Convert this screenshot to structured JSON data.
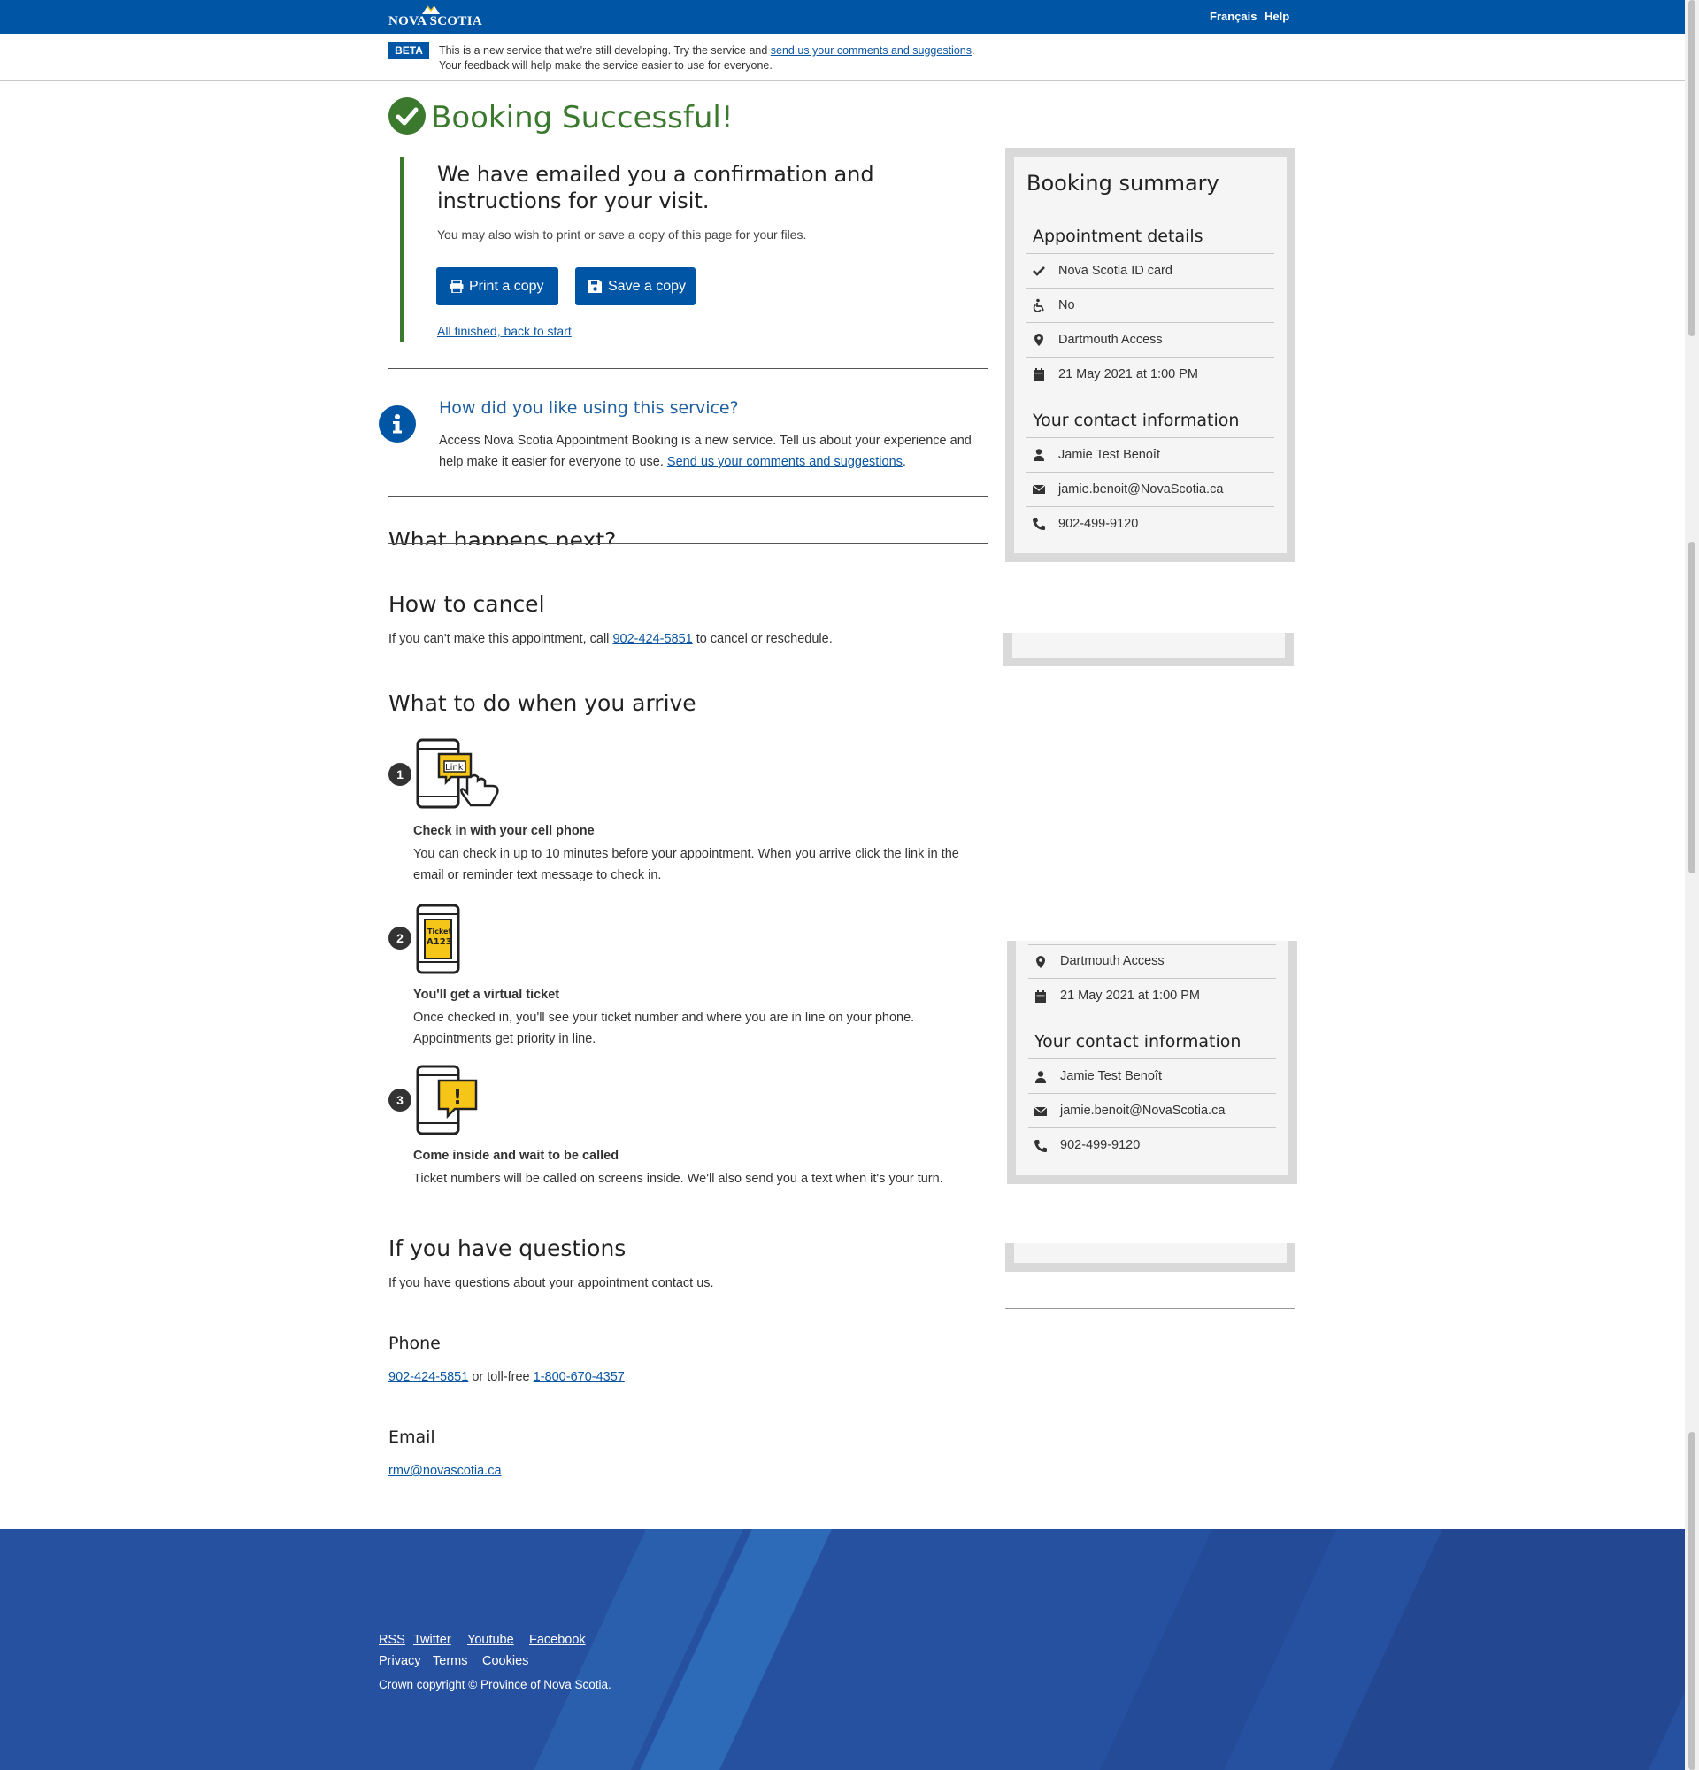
{
  "header": {
    "logo_text": "NOVA SCOTIA",
    "lang_link": "Français",
    "help_link": "Help"
  },
  "beta": {
    "badge": "BETA",
    "text_before": "This is a new service that we're still developing. Try the service and ",
    "link": "send us your comments and suggestions",
    "text_after": ".",
    "line2": "Your feedback will help make the service easier to use for everyone."
  },
  "success": {
    "title": "Booking Successful!",
    "heading": "We have emailed you a confirmation and instructions for your visit.",
    "subtext": "You may also wish to print or save a copy of this page for your files.",
    "print_label": "Print a copy",
    "save_label": "Save a copy",
    "finished_link": "All finished, back to start"
  },
  "feedback": {
    "question": "How did you like using this service?",
    "text": "Access Nova Scotia Appointment Booking is a new service. Tell us about your experience and help make it easier for everyone to use. ",
    "link": "Send us your comments and suggestions",
    "text_after": "."
  },
  "next": {
    "heading": "What happens next?"
  },
  "cancel": {
    "heading": "How to cancel",
    "text_before": "If you can't make this appointment, call ",
    "phone": "902-424-5851",
    "text_after": " to cancel or reschedule."
  },
  "arrive": {
    "heading": "What to do when you arrive",
    "steps": [
      {
        "num": "1",
        "title": "Check in with your cell phone",
        "text": "You can check in up to 10 minutes before your appointment. When you arrive click the link in the email or reminder text message to check in.",
        "illus_text": "Link"
      },
      {
        "num": "2",
        "title": "You'll get a virtual ticket",
        "text": "Once checked in, you'll see your ticket number and where you are in line on your phone. Appointments get priority in line.",
        "illus_text": "Ticket",
        "illus_text2": "A123"
      },
      {
        "num": "3",
        "title": "Come inside and wait to be called",
        "text": "Ticket numbers will be called on screens inside. We'll also send you a text when it's your turn.",
        "illus_text": "!"
      }
    ]
  },
  "questions": {
    "heading": "If you have questions",
    "text": "If you have questions about your appointment contact us.",
    "phone_heading": "Phone",
    "phone": "902-424-5851",
    "phone_mid": " or toll-free ",
    "tollfree": "1-800-670-4357",
    "email_heading": "Email",
    "email": "rmv@novascotia.ca"
  },
  "summary": {
    "title": "Booking summary",
    "appointment_heading": "Appointment details",
    "appointment": [
      {
        "icon": "check-icon",
        "text": "Nova Scotia ID card"
      },
      {
        "icon": "wheelchair-icon",
        "text": "No"
      },
      {
        "icon": "map-marker-icon",
        "text": "Dartmouth Access"
      },
      {
        "icon": "calendar-icon",
        "text": "21 May 2021 at 1:00 PM"
      }
    ],
    "contact_heading": "Your contact information",
    "contact": [
      {
        "icon": "user-icon",
        "text": "Jamie Test Benoît"
      },
      {
        "icon": "envelope-icon",
        "text": "jamie.benoit@NovaScotia.ca"
      },
      {
        "icon": "phone-icon",
        "text": "902-499-9120"
      }
    ]
  },
  "footer": {
    "links_row1": [
      "RSS",
      "Twitter",
      "Youtube",
      "Facebook"
    ],
    "links_row2": [
      "Privacy",
      "Terms",
      "Cookies"
    ],
    "copyright": "Crown copyright © Province of Nova Scotia."
  },
  "colors": {
    "brand_blue": "#0055a5",
    "success_green": "#3b7a2e",
    "footer_blue": "#2650a0"
  }
}
